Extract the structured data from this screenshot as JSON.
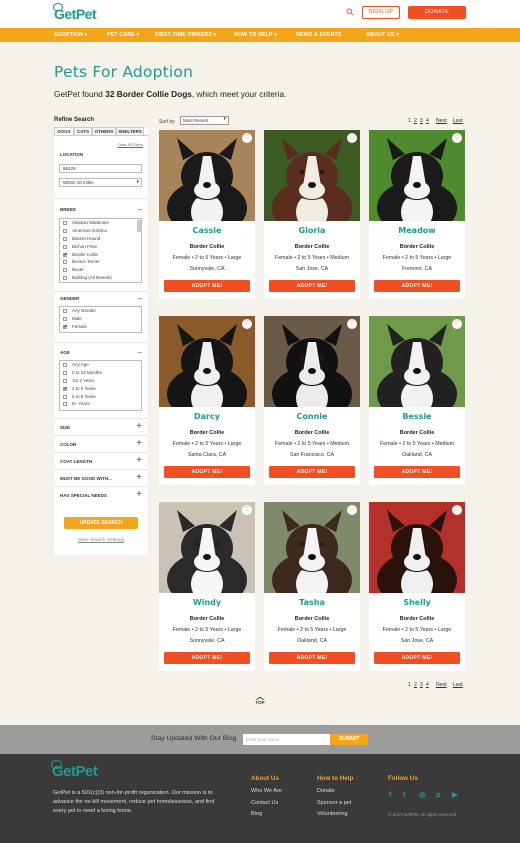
{
  "header": {
    "logo": "GetPet",
    "signup": "SIGN UP",
    "donate": "DONATE"
  },
  "nav": [
    "ADOPTION ▾",
    "PET CARE ▾",
    "FIRST-TIME OWNERS ▾",
    "HOW TO HELP ▾",
    "NEWS & EVENTS",
    "ABOUT US ▾"
  ],
  "page": {
    "title": "Pets For Adoption",
    "found_pre": "GetPet found ",
    "found_bold": "32 Border Collie Dogs",
    "found_post": ",  which meet your criteria."
  },
  "sidebar": {
    "title": "Refine Search",
    "tabs": [
      "DOGS",
      "CATS",
      "OTHERS",
      "SHELTERS"
    ],
    "clear": "Clear All Filters",
    "location_label": "LOCATION",
    "zip": "95125",
    "radius": "Within 10 miles",
    "breed_label": "BREED",
    "breeds": [
      {
        "l": "Alaskan Malamute",
        "c": false
      },
      {
        "l": "American Eskimo",
        "c": false
      },
      {
        "l": "Basset Hound",
        "c": false
      },
      {
        "l": "Bichon Frise",
        "c": false
      },
      {
        "l": "Border Collie",
        "c": true
      },
      {
        "l": "Boston Terrier",
        "c": false
      },
      {
        "l": "Boxer",
        "c": false
      },
      {
        "l": "Bulldog (All Breeds)",
        "c": false
      }
    ],
    "gender_label": "GENDER",
    "genders": [
      {
        "l": "Any Gender",
        "c": false
      },
      {
        "l": "Male",
        "c": false
      },
      {
        "l": "Female",
        "c": true
      }
    ],
    "age_label": "AGE",
    "ages": [
      {
        "l": "Any Age",
        "c": false
      },
      {
        "l": "0 to 12 Months",
        "c": false
      },
      {
        "l": "1to 2 Years",
        "c": false
      },
      {
        "l": "2 to 5 Years",
        "c": true
      },
      {
        "l": "5 to 8 Years",
        "c": false
      },
      {
        "l": "8+ Years",
        "c": false
      }
    ],
    "more": [
      "SIZE",
      "COLOR",
      "COAT LENGTH",
      "MUST BE GOOD WITH...",
      "HAS SPECIAL NEEDS"
    ],
    "update": "UPDATE SEARCH",
    "save": "Save Search Settings"
  },
  "sort": {
    "label": "Sort by",
    "value": "Most Recent"
  },
  "pager": {
    "pages": [
      "1",
      "2",
      "3",
      "4"
    ],
    "next": "Next",
    "last": "Last"
  },
  "pets": [
    {
      "name": "Cassie",
      "breed": "Border Collie",
      "desc": "Female • 2 to 5 Years • Large",
      "loc": "Sunnyvale, CA"
    },
    {
      "name": "Gloria",
      "breed": "Border Collie",
      "desc": "Female • 2 to 5 Years • Medium",
      "loc": "San Jose, CA"
    },
    {
      "name": "Meadow",
      "breed": "Border Collie",
      "desc": "Female • 2 to 5 Years • Large",
      "loc": "Fremont, CA"
    },
    {
      "name": "Darcy",
      "breed": "Border Collie",
      "desc": "Female • 2 to 5 Years • Large",
      "loc": "Santa Clara, CA"
    },
    {
      "name": "Connie",
      "breed": "Border Collie",
      "desc": "Female • 2 to 5 Years • Medium",
      "loc": "San Francisco, CA"
    },
    {
      "name": "Bessie",
      "breed": "Border Collie",
      "desc": "Female • 2 to 5 Years • Medium",
      "loc": "Oakland, CA"
    },
    {
      "name": "Windy",
      "breed": "Border Collie",
      "desc": "Female • 2 to 5 Years • Large",
      "loc": "Sunnyvale, CA"
    },
    {
      "name": "Tasha",
      "breed": "Border Collie",
      "desc": "Female • 2 to 5 Years • Large",
      "loc": "Oakland, CA"
    },
    {
      "name": "Shelly",
      "breed": "Border Collie",
      "desc": "Female • 2 to 5 Years • Large",
      "loc": "San Jose, CA"
    }
  ],
  "adopt": "ADOPT ME!",
  "top": "TOP",
  "blog": {
    "label": "Stay Updated With Our Blog",
    "placeholder": "Enter your email",
    "submit": "SUBMIT"
  },
  "footer": {
    "logo": "GetPet",
    "about": "GetPet is a 501(c)(3) non-for-profit organization. Our mission is to advance the no-kill movement, reduce pet homelessness, and find every pet in need a loving home.",
    "col1": {
      "h": "About Us",
      "links": [
        "Who We Are",
        "Contact Us",
        "Blog"
      ]
    },
    "col2": {
      "h": "How to Help",
      "links": [
        "Donate",
        "Sponsor a pet",
        "Volunteering"
      ]
    },
    "col3": {
      "h": "Follow Us"
    },
    "social": [
      "facebook-icon",
      "twitter-icon",
      "instagram-icon",
      "pinterest-icon",
      "youtube-icon"
    ],
    "copyright": "© 2017 GetPet.  All rights reserved."
  }
}
